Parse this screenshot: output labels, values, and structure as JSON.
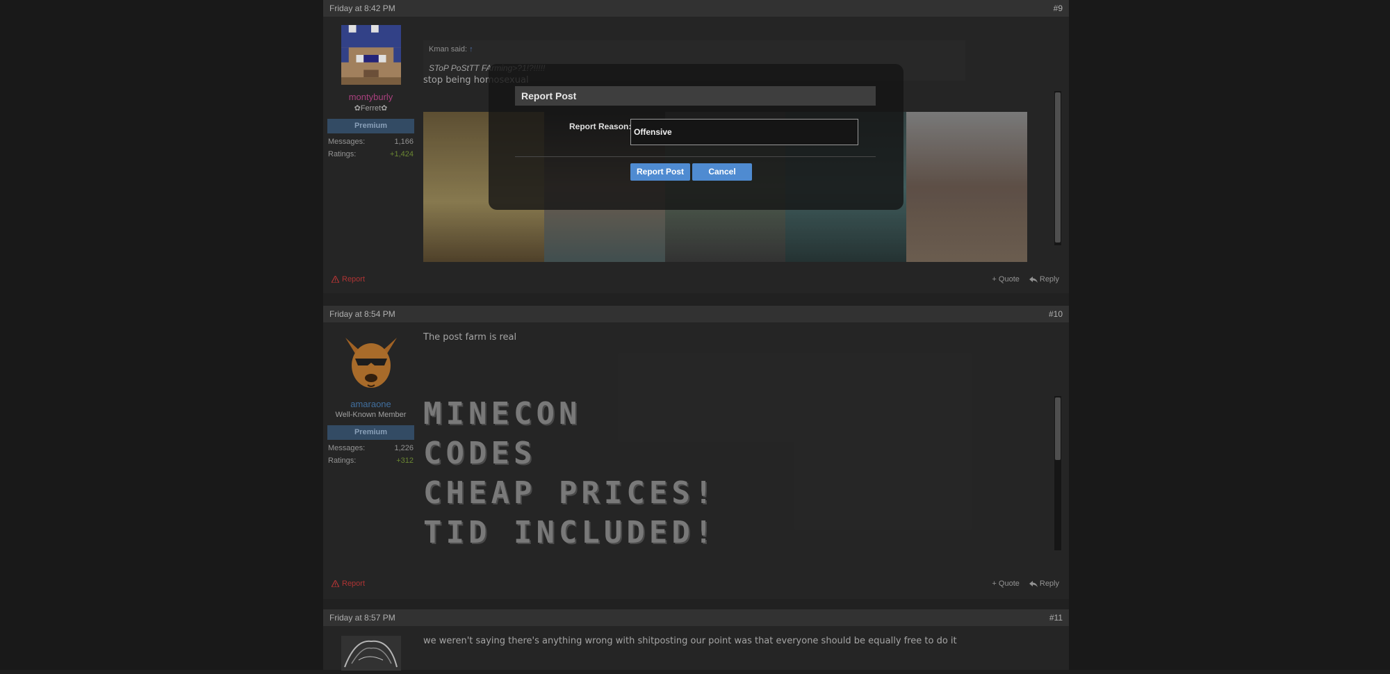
{
  "posts": [
    {
      "timestamp": "Friday at 8:42 PM",
      "number": "#9",
      "user": {
        "name": "montyburly",
        "title": "✿Ferret✿",
        "badge": "Premium",
        "name_color": "#c0498f"
      },
      "stats": [
        {
          "label": "Messages:",
          "value": "1,166"
        },
        {
          "label": "Ratings:",
          "value": "+1,424"
        }
      ],
      "quote": {
        "author": "Kman said:",
        "arrow": "↑",
        "text": "SToP PoStTT FArming>?1!?!!!!!"
      },
      "message": "stop being homosexual"
    },
    {
      "timestamp": "Friday at 8:54 PM",
      "number": "#10",
      "user": {
        "name": "amaraone",
        "title": "Well-Known Member",
        "badge": "Premium",
        "name_color": "#4a7fb5"
      },
      "stats": [
        {
          "label": "Messages:",
          "value": "1,226"
        },
        {
          "label": "Ratings:",
          "value": "+312"
        }
      ],
      "message": "The post farm is real",
      "image_text": [
        "MINECON",
        "CODES",
        "CHEAP PRICES!",
        "TID INCLUDED!"
      ]
    },
    {
      "timestamp": "Friday at 8:57 PM",
      "number": "#11",
      "message": "we weren't saying there's anything wrong with shitposting our point was that everyone should be equally free to do it"
    }
  ],
  "footer": {
    "report": "Report",
    "quote": "+ Quote",
    "reply": "Reply"
  },
  "modal": {
    "title": "Report Post",
    "reason_label": "Report Reason:",
    "reason_value": "Offensive",
    "submit": "Report Post",
    "cancel": "Cancel"
  },
  "colors": {
    "accent": "#4f8bd1",
    "report": "#c83c3c",
    "positive": "#7a9a3a"
  }
}
